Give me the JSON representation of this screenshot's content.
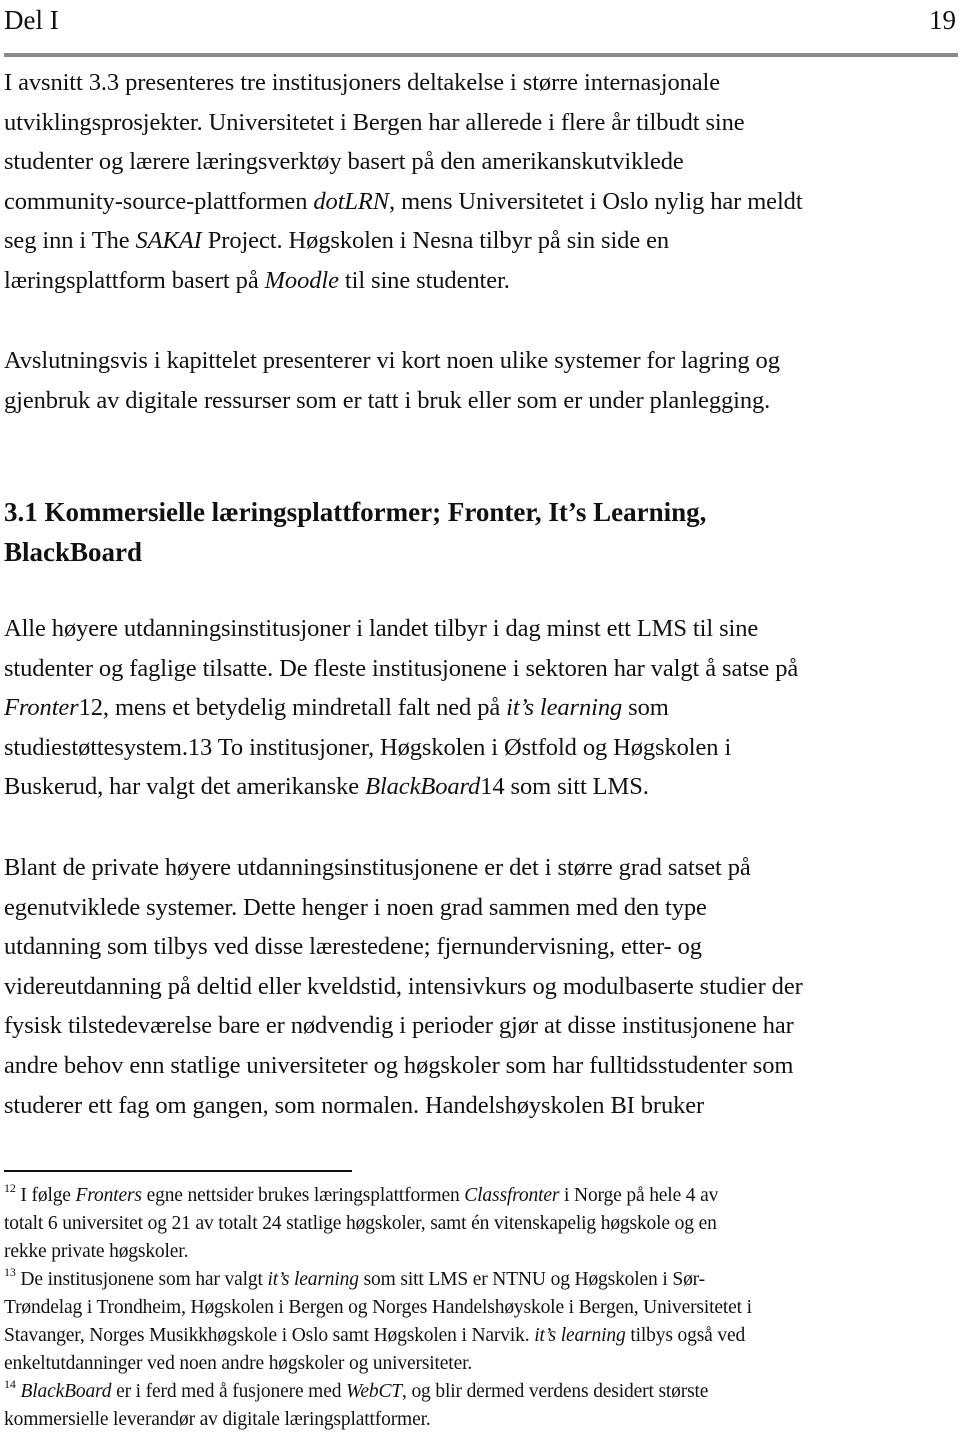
{
  "header": {
    "section": "Del I",
    "page_number": "19"
  },
  "paragraphs": {
    "intro": {
      "l1": "I avsnitt 3.3 presenteres tre institusjoners deltakelse i større internasjonale",
      "l2": "utviklingsprosjekter. Universitetet i Bergen har allerede i flere år tilbudt sine",
      "l3": "studenter og lærere læringsverktøy basert på den amerikanskutviklede",
      "l4a": "community-source-plattformen ",
      "l4i": "dotLRN",
      "l4b": ", mens Universitetet i Oslo nylig har meldt",
      "l5a": "seg inn i The ",
      "l5i": "SAKAI",
      "l5b": " Project. Høgskolen i Nesna tilbyr på sin side en",
      "l6a": "læringsplattform basert på ",
      "l6i": "Moodle",
      "l6b": " til sine studenter."
    },
    "closing": {
      "l1": "Avslutningsvis i kapittelet presenterer vi kort noen ulike systemer for lagring og",
      "l2": "gjenbruk av digitale ressurser som er tatt i bruk eller som er under planlegging."
    },
    "lms": {
      "l1": "Alle høyere utdanningsinstitusjoner i landet tilbyr i dag minst ett LMS til sine",
      "l2": "studenter og faglige tilsatte. De fleste institusjonene i sektoren har valgt å satse på",
      "l3i1": "Fronter",
      "l3a": "12, mens et betydelig mindretall falt ned på ",
      "l3i2": "it’s learning",
      "l3b": " som",
      "l4": "studiestøttesystem.13 To institusjoner, Høgskolen i Østfold og Høgskolen i",
      "l5a": "Buskerud, har valgt det amerikanske ",
      "l5i": "BlackBoard",
      "l5b": "14 som sitt LMS."
    },
    "private": {
      "l1": "Blant de private høyere utdanningsinstitusjonene er det i større grad satset på",
      "l2": "egenutviklede systemer. Dette henger i noen grad sammen med den type",
      "l3": "utdanning som tilbys ved disse lærestedene; fjernundervisning, etter- og",
      "l4": "videreutdanning på deltid eller kveldstid, intensivkurs og modulbaserte studier der",
      "l5": "fysisk tilstedeværelse bare er nødvendig i perioder gjør at disse institusjonene har",
      "l6": "andre behov enn statlige universiteter og høgskoler som har fulltidsstudenter som",
      "l7": "studerer ett fag om gangen, som normalen. Handelshøyskolen BI bruker"
    }
  },
  "section_heading": {
    "l1": "3.1 Kommersielle læringsplattformer; Fronter, It’s Learning,",
    "l2": "BlackBoard"
  },
  "footnotes": {
    "fn12": {
      "marker": "12",
      "l1a": " I følge ",
      "l1i1": "Fronters",
      "l1b": " egne nettsider brukes læringsplattformen ",
      "l1i2": "Classfronter",
      "l1c": " i Norge på hele 4 av",
      "l2": "totalt 6 universitet og 21 av totalt 24 statlige høgskoler, samt én vitenskapelig høgskole og en",
      "l3": "rekke private høgskoler."
    },
    "fn13": {
      "marker": "13",
      "l1a": " De institusjonene som har valgt ",
      "l1i": "it’s learning",
      "l1b": " som sitt LMS er NTNU og Høgskolen i Sør-",
      "l2": "Trøndelag i Trondheim, Høgskolen i Bergen og Norges Handelshøyskole i Bergen, Universitetet i",
      "l3a": "Stavanger, Norges Musikkhøgskole i Oslo samt Høgskolen i Narvik. ",
      "l3i": "it’s learning",
      "l3b": " tilbys også ved",
      "l4": "enkeltutdanninger ved noen andre høgskoler og universiteter."
    },
    "fn14": {
      "marker": "14",
      "l1sp": " ",
      "l1i1": "BlackBoard",
      "l1a": " er i ferd med å fusjonere med ",
      "l1i2": "WebCT",
      "l1b": ", og blir dermed verdens desidert største",
      "l2": "kommersielle leverandør av digitale læringsplattformer."
    }
  }
}
